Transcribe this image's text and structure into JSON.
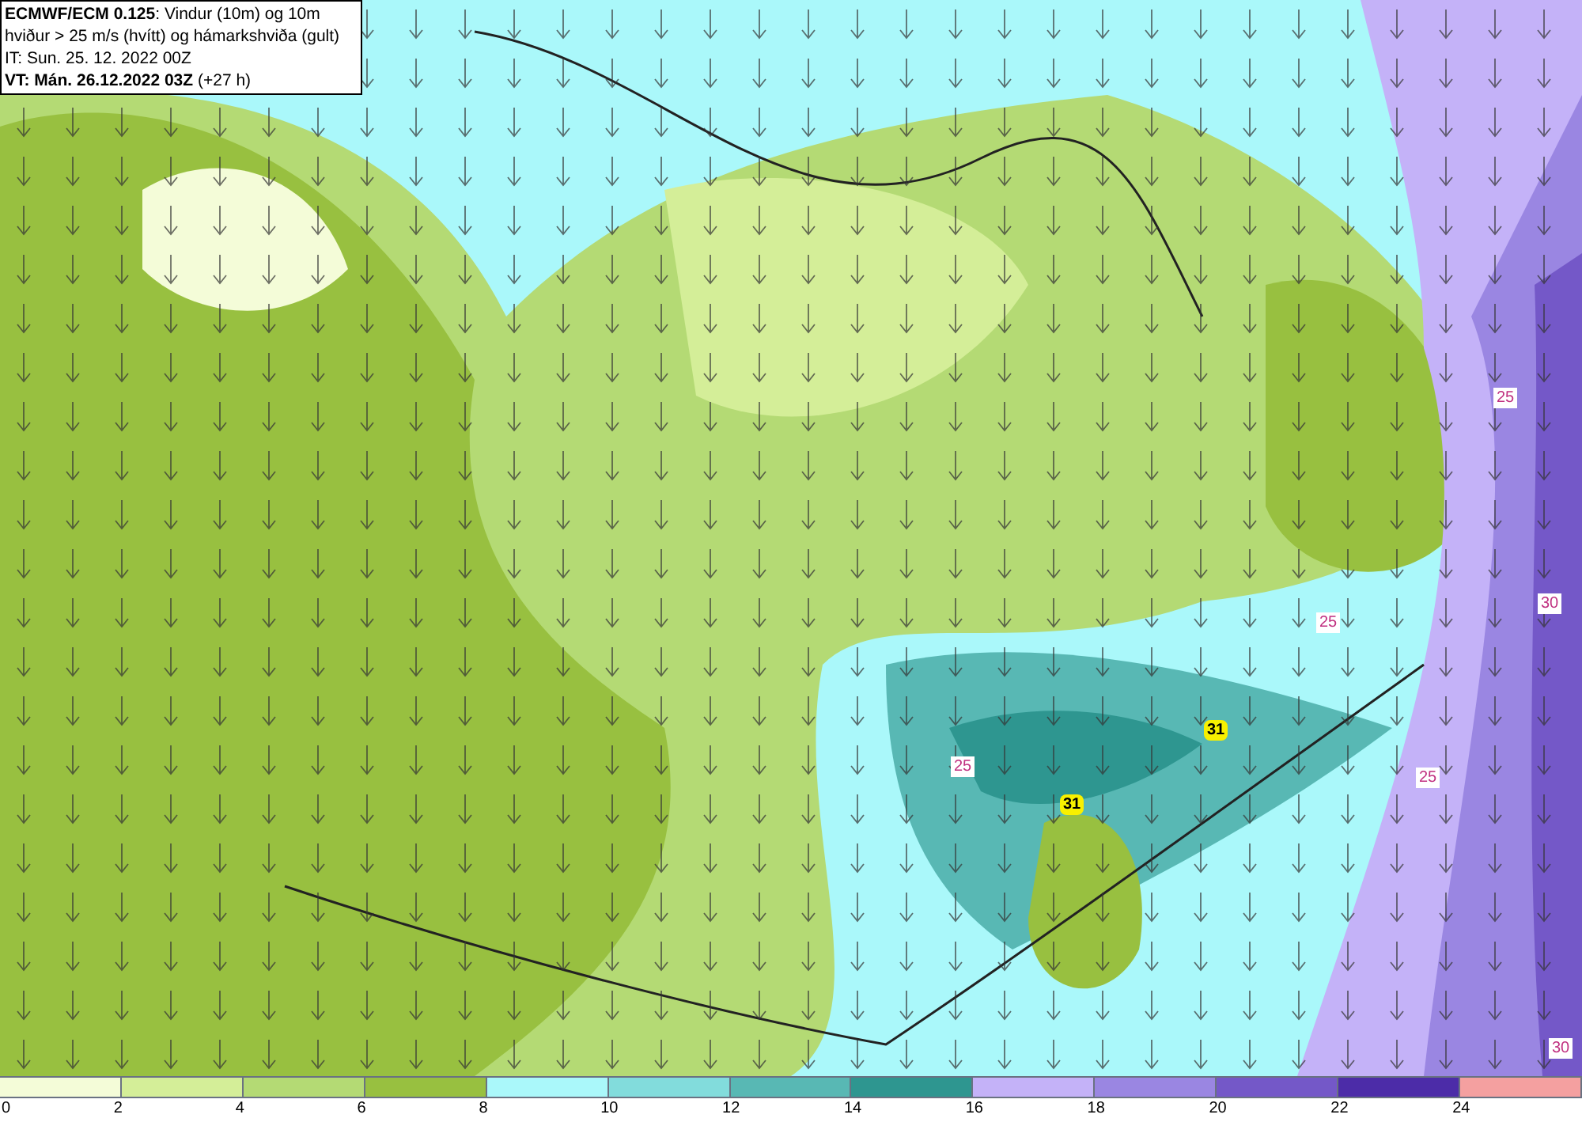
{
  "title_box": {
    "lines": [
      "**ECMWF/ECM 0.125**: Vindur (10m) og 10m",
      "hviður > 25 m/s (hvítt) og hámarkshviða (gult)",
      "IT: Sun. 25. 12. 2022 00Z",
      "**VT: Mán. 26.12.2022 03Z** (+27 h)"
    ]
  },
  "map_labels": [
    {
      "kind": "contour",
      "text": "25"
    },
    {
      "kind": "contour",
      "text": "30"
    },
    {
      "kind": "contour",
      "text": "25"
    },
    {
      "kind": "max_gust",
      "text": "31"
    },
    {
      "kind": "contour",
      "text": "25"
    },
    {
      "kind": "max_gust",
      "text": "31"
    },
    {
      "kind": "contour",
      "text": "25"
    },
    {
      "kind": "contour",
      "text": "30"
    }
  ],
  "legend": {
    "bins": [
      {
        "color": "#f4fcd8"
      },
      {
        "color": "#d4ee98"
      },
      {
        "color": "#b4da74"
      },
      {
        "color": "#98c040"
      },
      {
        "color": "#aaf8fa"
      },
      {
        "color": "#82dcdc"
      },
      {
        "color": "#58b8b4"
      },
      {
        "color": "#2e9690"
      },
      {
        "color": "#c4b2f8"
      },
      {
        "color": "#9a86e2"
      },
      {
        "color": "#7458c8"
      },
      {
        "color": "#4c2ca8"
      },
      {
        "color": "#f4a0a0"
      }
    ],
    "ticks": [
      "0",
      "2",
      "4",
      "6",
      "8",
      "10",
      "12",
      "14",
      "16",
      "18",
      "20",
      "22",
      "24"
    ]
  }
}
